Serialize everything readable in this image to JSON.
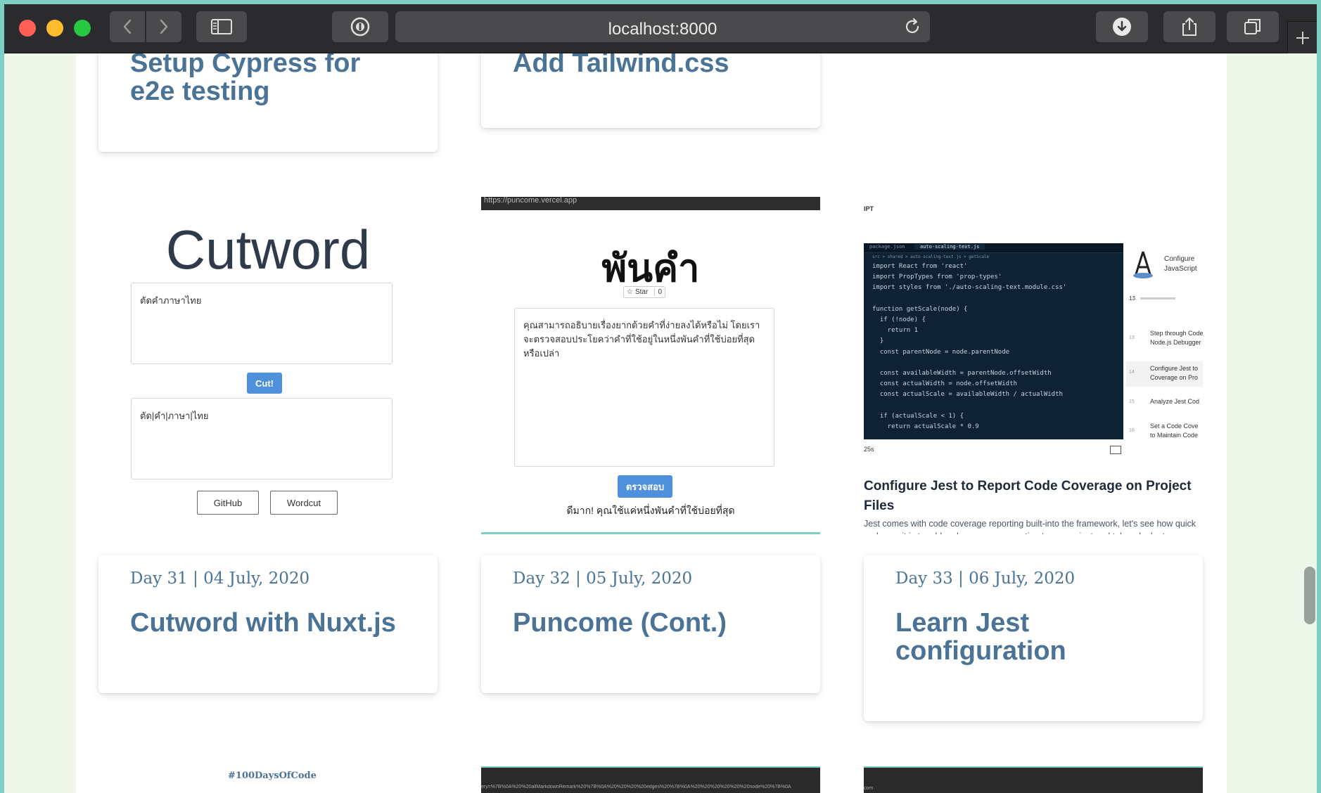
{
  "browser": {
    "url": "localhost:8000"
  },
  "cards_top": [
    {
      "title_lines": [
        "Setup Cypress for",
        "e2e testing"
      ]
    },
    {
      "title_lines": [
        "Add Tailwind.css"
      ]
    }
  ],
  "cards": [
    {
      "date": "Day 31 | 04 July, 2020",
      "title": "Cutword with Nuxt.js",
      "preview": {
        "heading": "Cutword",
        "input_text": "ตัดคำภาษาไทย",
        "cut_label": "Cut!",
        "output_text": "ตัด|คำ|ภาษา|ไทย",
        "github_label": "GitHub",
        "wordcut_label": "Wordcut"
      }
    },
    {
      "date": "Day 32 | 05 July, 2020",
      "title": "Puncome (Cont.)",
      "preview": {
        "url": "https://puncome.vercel.app",
        "heading": "พันคำ",
        "star_label": "Star",
        "star_count": "0",
        "textarea_text": "คุณสามารถอธิบายเรื่องยากด้วยคำที่ง่ายลงได้หรือไม่ โดยเราจะตรวจสอบประโยคว่าคำที่ใช้อยู่ในหนึ่งพันคำที่ใช้บ่อยที่สุดหรือเปล่า",
        "submit_label": "ตรวจสอบ",
        "result_text": "ดีมาก! คุณใช้แค่หนึ่งพันคำที่ใช้บ่อยที่สุด"
      }
    },
    {
      "date": "Day 33 | 06 July, 2020",
      "title_lines": [
        "Learn Jest",
        "configuration"
      ],
      "preview": {
        "top_label": "IPT",
        "video_title": "Configure Jest to Report Code Coverage on Project Files",
        "video_desc": "Jest comes with code coverage reporting built-into the framework, let's see how quick and easy it is to add code coverage reporting to our project and take a look at",
        "duration": "25s",
        "side_header": "Configure JavaScript",
        "side_count": "13",
        "side_items": [
          {
            "num": "13",
            "text": "Step through Code Node.js Debugger"
          },
          {
            "num": "14",
            "text": "Configure Jest to Coverage on Pro"
          },
          {
            "num": "15",
            "text": "Analyze Jest Cod"
          },
          {
            "num": "16",
            "text": "Set a Code Cove to Maintain Code"
          }
        ],
        "code_tabs": [
          "package.json",
          "auto-scaling-text.js"
        ],
        "code_breadcrumb": "src > shared > auto-scaling-text.js > getScale",
        "code_lines": [
          "import React from 'react'",
          "import PropTypes from 'prop-types'",
          "import styles from './auto-scaling-text.module.css'",
          "",
          "function getScale(node) {",
          "  if (!node) {",
          "    return 1",
          "  }",
          "  const parentNode = node.parentNode",
          "",
          "  const availableWidth = parentNode.offsetWidth",
          "  const actualWidth = node.offsetWidth",
          "  const actualScale = availableWidth / actualWidth",
          "",
          "  if (actualScale < 1) {",
          "    return actualScale * 0.9"
        ]
      }
    }
  ],
  "bottom_row": {
    "hashtag": "#100DaysOfCode",
    "strip2_text": "ery=%7B%0A%20%20allMarkdownRemark%20%7B%0A%20%20%20%20edges%20%7B%0A%20%20%20%20%20%20node%20%7B%0A",
    "strip3_text": "com"
  }
}
